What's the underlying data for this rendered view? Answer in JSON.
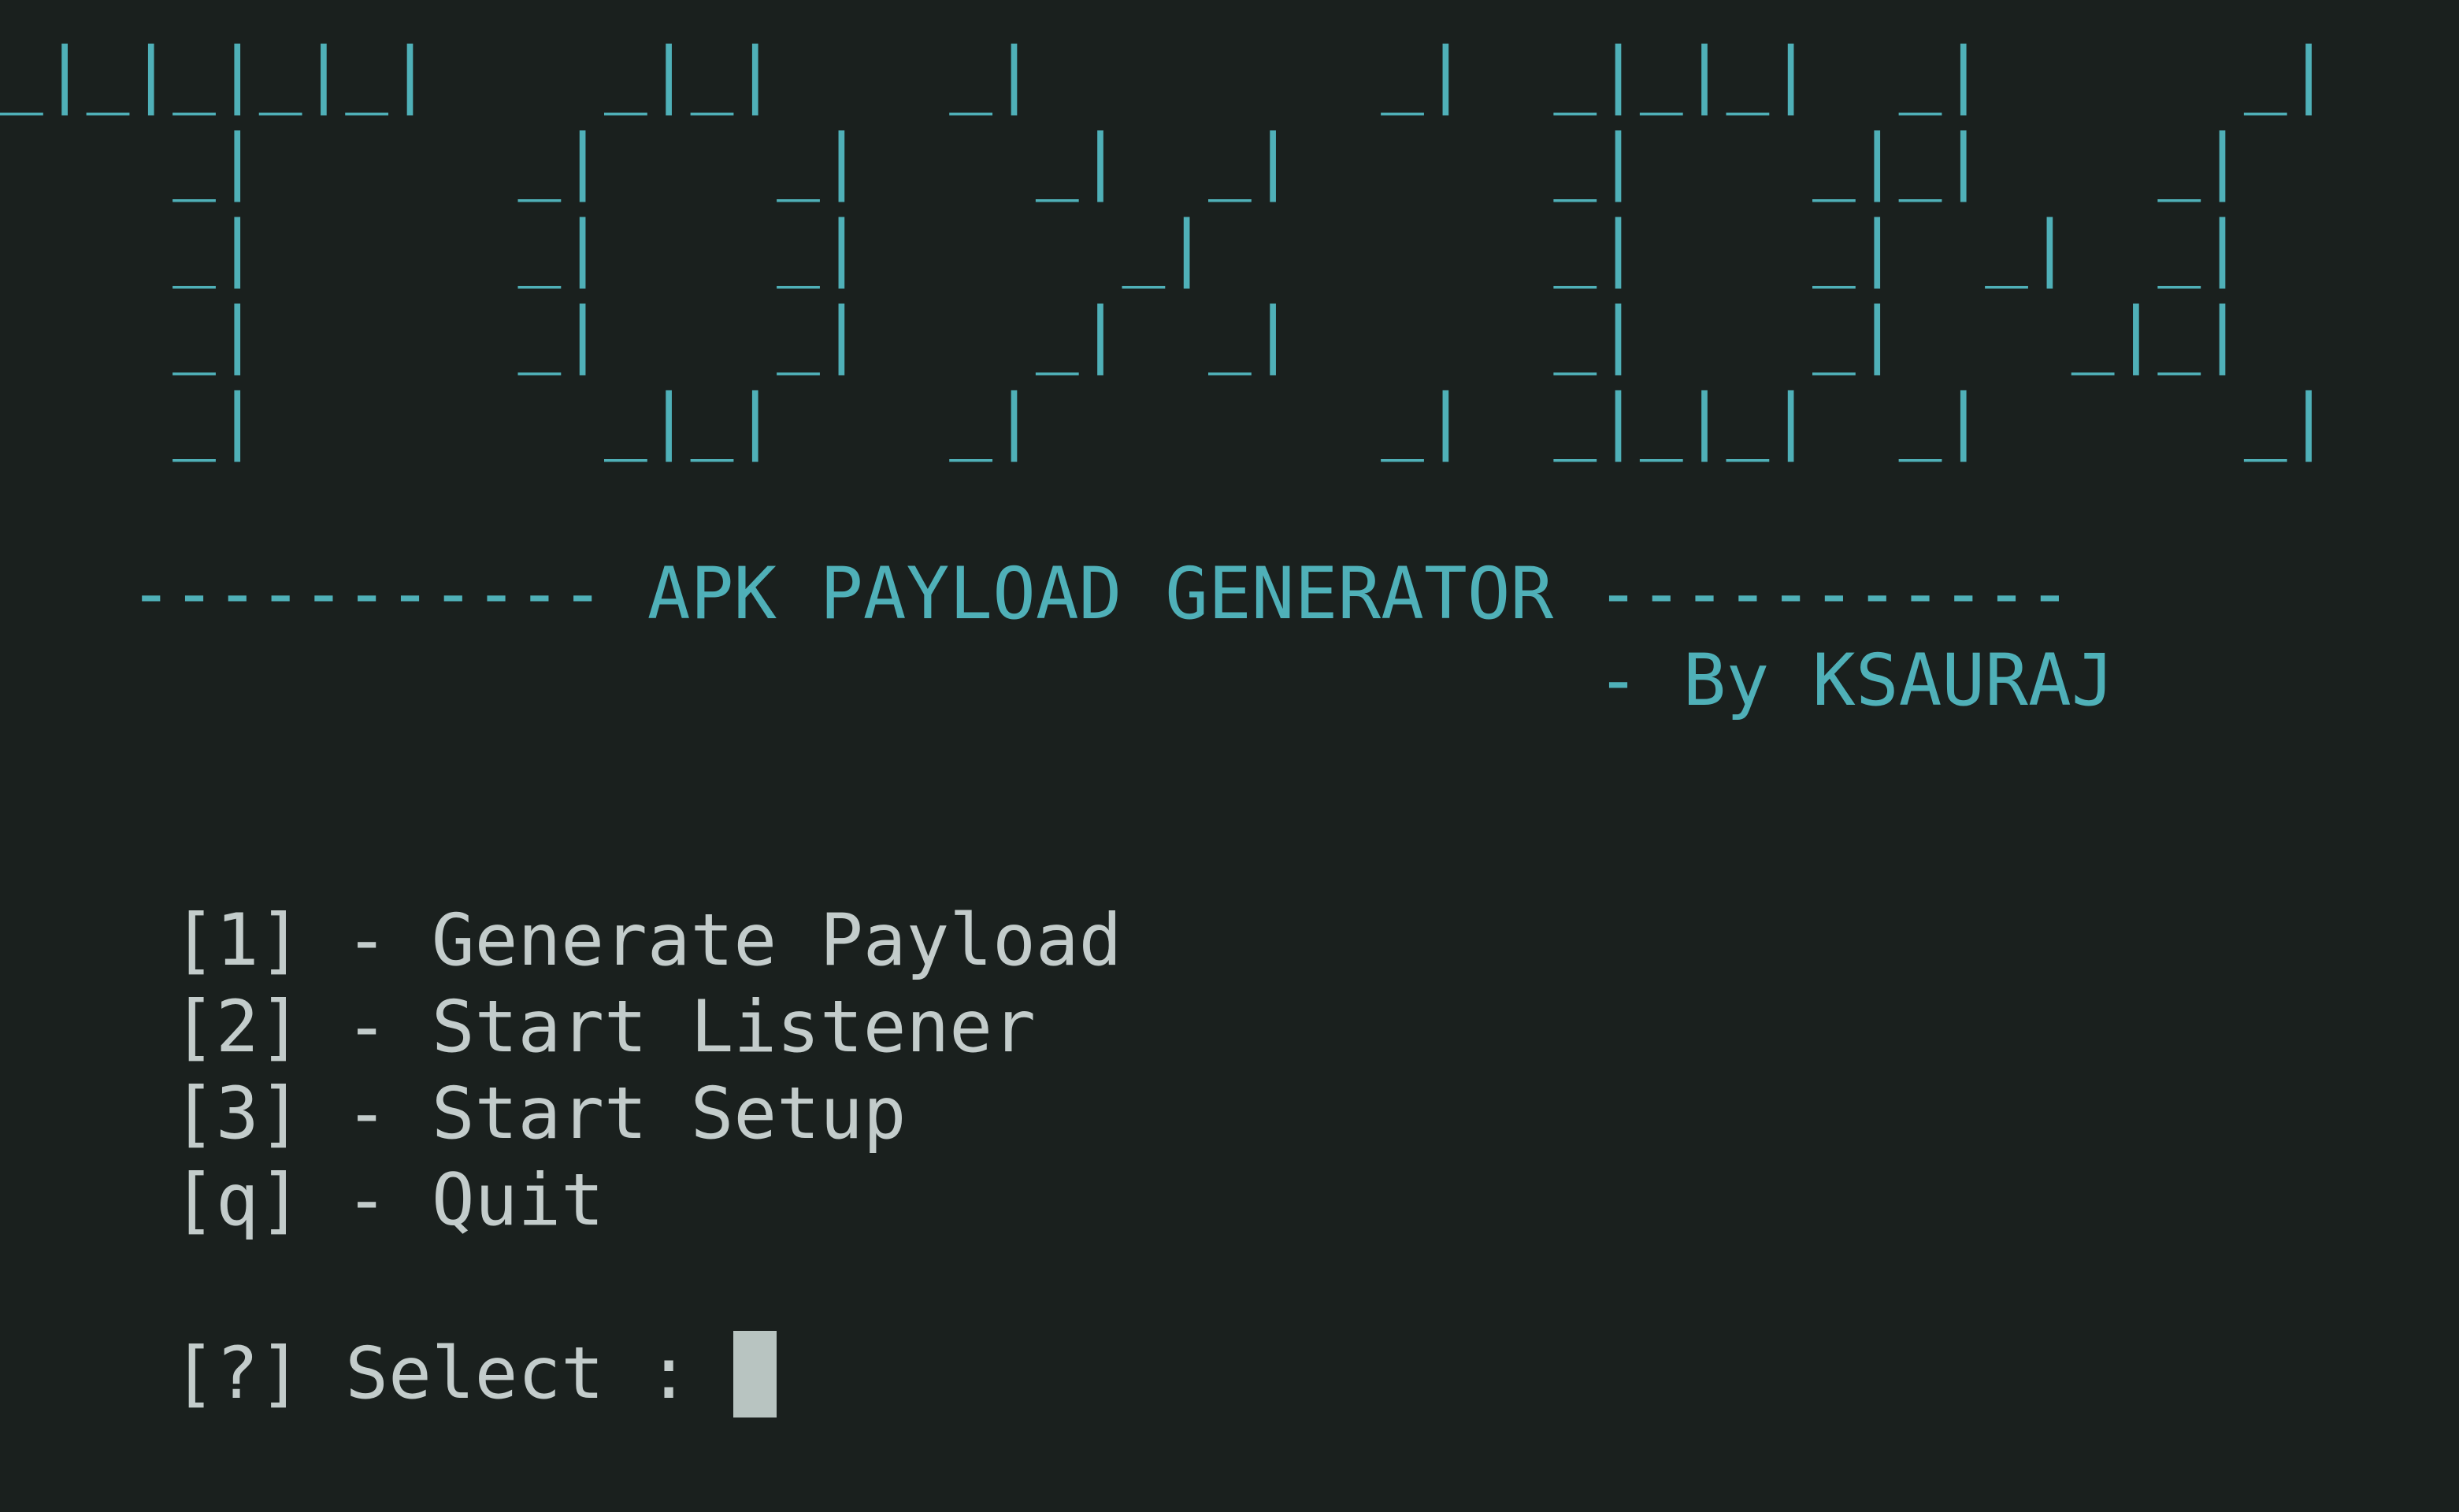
{
  "terminal": {
    "banner_lines": [
      "_|_|_|_|_|    _|_|    _|        _|  _|_|_|  _|      _|",
      "    _|      _|    _|    _|  _|      _|    _|_|    _|",
      "    _|      _|    _|      _|        _|    _|  _|  _|",
      "    _|      _|    _|    _|  _|      _|    _|    _|_|",
      "    _|        _|_|    _|        _|  _|_|_|  _|      _|"
    ],
    "title": "   ----------- APK PAYLOAD GENERATOR -----------",
    "author": "                                     - By KSAURAJ",
    "menu": [
      "    [1] - Generate Payload",
      "    [2] - Start Listener",
      "    [3] - Start Setup",
      "    [q] - Quit"
    ],
    "prompt": "    [?] Select : ",
    "colors": {
      "background": "#1a201e",
      "accent": "#4fb0b8",
      "text": "#c3cccb",
      "cursor": "#b8c4c1"
    }
  }
}
